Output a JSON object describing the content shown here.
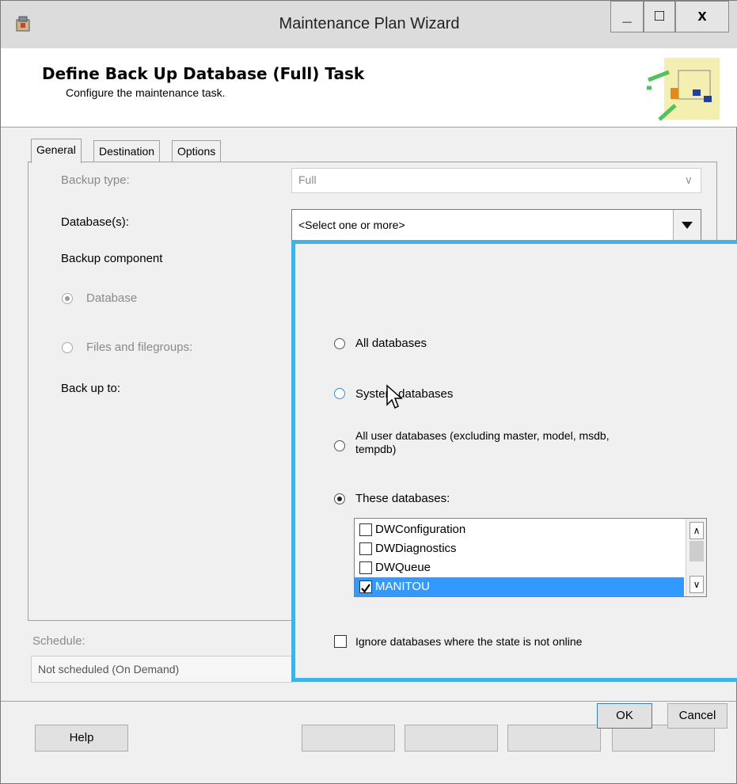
{
  "window": {
    "title": "Maintenance Plan Wizard",
    "minimize": "_",
    "maximize": "□",
    "close": "x"
  },
  "header": {
    "title": "Define Back Up Database (Full) Task",
    "subtitle": "Configure the maintenance task."
  },
  "tabs": [
    "General",
    "Destination",
    "Options"
  ],
  "general": {
    "backup_type_label": "Backup type:",
    "backup_type_value": "Full",
    "databases_label": "Database(s):",
    "databases_value": "<Select one or more>",
    "backup_component_label": "Backup component",
    "database_option": "Database",
    "files_option": "Files and filegroups:",
    "back_up_to_label": "Back up to:"
  },
  "schedule": {
    "label": "Schedule:",
    "value": "Not scheduled (On Demand)"
  },
  "footer": {
    "help": "Help"
  },
  "popup": {
    "all_databases": "All databases",
    "system_databases": "System databases",
    "all_user_databases_line1": "All user databases  (excluding master, model, msdb,",
    "all_user_databases_line2": "tempdb)",
    "these_databases": "These databases:",
    "selected_option": "These databases:",
    "databases": [
      {
        "name": "DWConfiguration",
        "checked": false
      },
      {
        "name": "DWDiagnostics",
        "checked": false
      },
      {
        "name": "DWQueue",
        "checked": false
      },
      {
        "name": "MANITOU",
        "checked": true
      }
    ],
    "ignore_offline": "Ignore databases where the state is not online",
    "ok": "OK",
    "cancel": "Cancel"
  },
  "colors": {
    "popup_border": "#42b2e6",
    "selection": "#3399ff"
  }
}
